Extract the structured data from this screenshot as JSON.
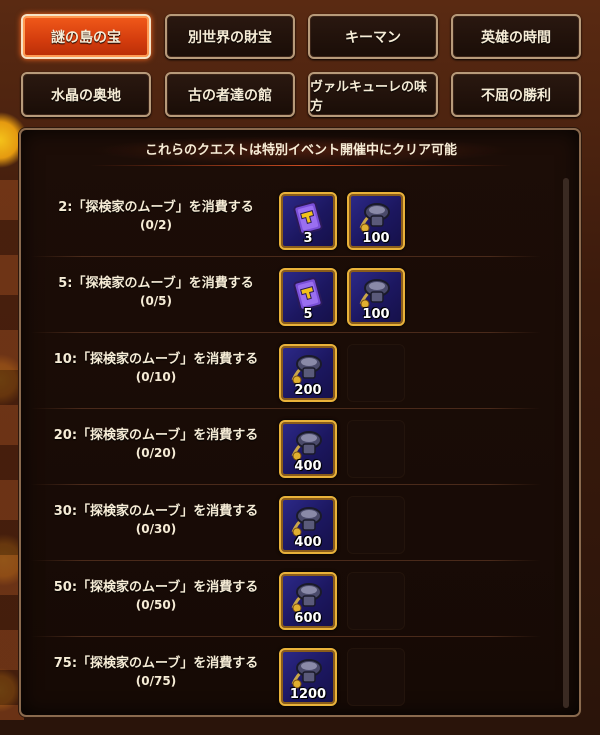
{
  "tabs": [
    {
      "label": "謎の島の宝",
      "active": true
    },
    {
      "label": "別世界の財宝",
      "active": false
    },
    {
      "label": "キーマン",
      "active": false
    },
    {
      "label": "英雄の時間",
      "active": false
    },
    {
      "label": "水晶の奥地",
      "active": false
    },
    {
      "label": "古の者達の館",
      "active": false
    },
    {
      "label": "ヴァルキューレの味方",
      "active": false
    },
    {
      "label": "不屈の勝利",
      "active": false
    }
  ],
  "panel": {
    "banner": "これらのクエストは特別イベント開催中にクリア可能"
  },
  "quests": [
    {
      "title": "2:「探検家のムーブ」を消費する",
      "progress": "(0/2)",
      "rewards": [
        {
          "icon": "ticket-icon",
          "qty": "3"
        },
        {
          "icon": "relic-icon",
          "qty": "100"
        }
      ]
    },
    {
      "title": "5:「探検家のムーブ」を消費する",
      "progress": "(0/5)",
      "rewards": [
        {
          "icon": "ticket-icon",
          "qty": "5"
        },
        {
          "icon": "relic-icon",
          "qty": "100"
        }
      ]
    },
    {
      "title": "10:「探検家のムーブ」を消費する",
      "progress": "(0/10)",
      "rewards": [
        {
          "icon": "relic-icon",
          "qty": "200"
        }
      ]
    },
    {
      "title": "20:「探検家のムーブ」を消費する",
      "progress": "(0/20)",
      "rewards": [
        {
          "icon": "relic-icon",
          "qty": "400"
        }
      ]
    },
    {
      "title": "30:「探検家のムーブ」を消費する",
      "progress": "(0/30)",
      "rewards": [
        {
          "icon": "relic-icon",
          "qty": "400"
        }
      ]
    },
    {
      "title": "50:「探検家のムーブ」を消費する",
      "progress": "(0/50)",
      "rewards": [
        {
          "icon": "relic-icon",
          "qty": "600"
        }
      ]
    },
    {
      "title": "75:「探検家のムーブ」を消費する",
      "progress": "(0/75)",
      "rewards": [
        {
          "icon": "relic-icon",
          "qty": "1200"
        }
      ]
    }
  ],
  "colors": {
    "active_tab": "#e2461a",
    "reward_border": "#e9b23a",
    "reward_bg": "#1c1760"
  }
}
